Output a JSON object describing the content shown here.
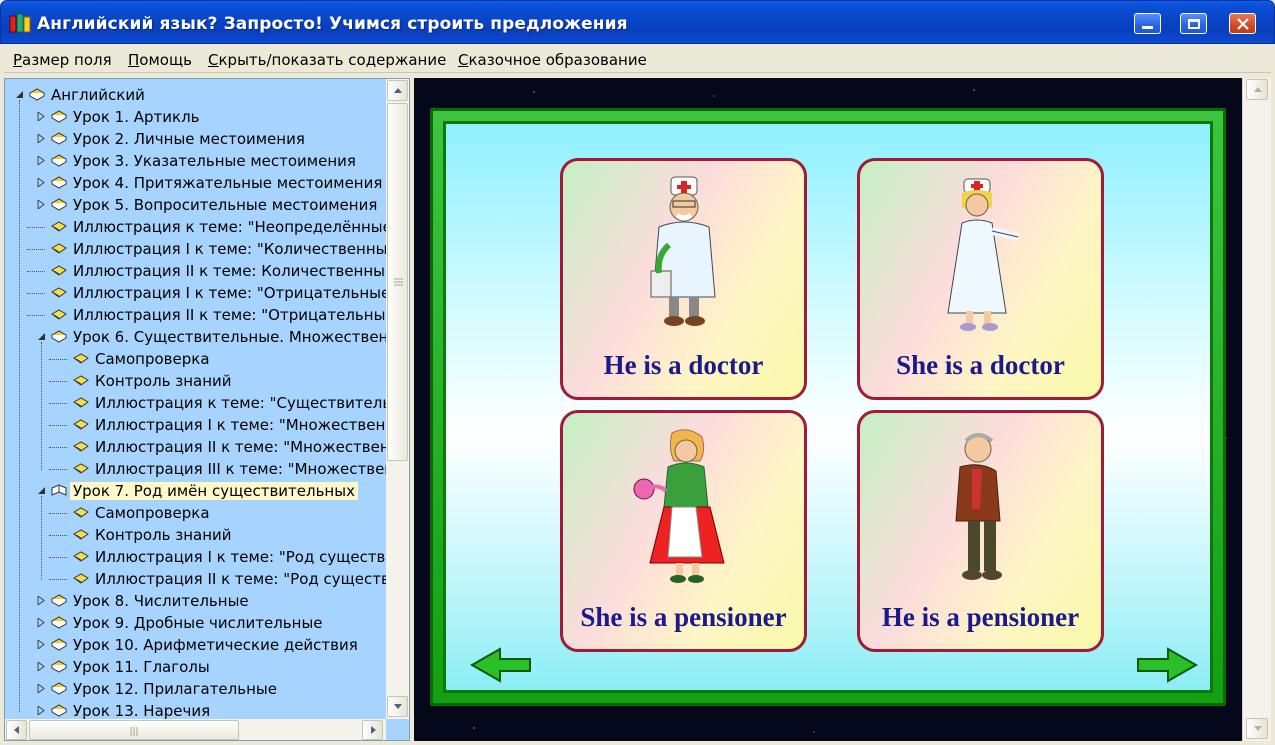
{
  "window": {
    "title": "Английский язык? Запросто! Учимся строить предложения"
  },
  "menu": {
    "items": [
      {
        "label": "Размер поля",
        "underline": "Р",
        "rest": "азмер поля"
      },
      {
        "label": "Помощь",
        "underline": "П",
        "rest": "омощь"
      },
      {
        "label": "Скрыть/показать содержание",
        "underline": "С",
        "rest": "крыть/показать содержание"
      },
      {
        "label": "Сказочное образование",
        "underline": "С",
        "rest": "казочное образование"
      }
    ]
  },
  "tree": {
    "items": [
      {
        "label": "Английский",
        "level": 0,
        "expander": "open",
        "icon": "book-icon"
      },
      {
        "label": "Урок 1. Артикль",
        "level": 1,
        "expander": "closed",
        "icon": "book-icon"
      },
      {
        "label": "Урок 2. Личные местоимения",
        "level": 1,
        "expander": "closed",
        "icon": "book-icon"
      },
      {
        "label": "Урок 3. Указательные местоимения",
        "level": 1,
        "expander": "closed",
        "icon": "book-icon"
      },
      {
        "label": "Урок 4. Притяжательные местоимения",
        "level": 1,
        "expander": "closed",
        "icon": "book-icon"
      },
      {
        "label": "Урок 5. Вопросительные местоимения",
        "level": 1,
        "expander": "closed",
        "icon": "book-icon"
      },
      {
        "label": "Иллюстрация к теме: \"Неопределённые",
        "level": 1,
        "expander": "none",
        "icon": "page-icon"
      },
      {
        "label": "Иллюстрация I к теме: \"Количественные",
        "level": 1,
        "expander": "none",
        "icon": "page-icon"
      },
      {
        "label": "Иллюстрация II к теме: Количественные",
        "level": 1,
        "expander": "none",
        "icon": "page-icon"
      },
      {
        "label": "Иллюстрация I к теме: \"Отрицательные",
        "level": 1,
        "expander": "none",
        "icon": "page-icon"
      },
      {
        "label": "Иллюстрация II к теме: \"Отрицательные",
        "level": 1,
        "expander": "none",
        "icon": "page-icon"
      },
      {
        "label": "Урок 6. Существительные. Множественн",
        "level": 1,
        "expander": "open",
        "icon": "book-icon"
      },
      {
        "label": "Самопроверка",
        "level": 2,
        "expander": "none",
        "icon": "page-icon"
      },
      {
        "label": "Контроль знаний",
        "level": 2,
        "expander": "none",
        "icon": "page-icon"
      },
      {
        "label": "Иллюстрация к теме: \"Существитель",
        "level": 2,
        "expander": "none",
        "icon": "page-icon"
      },
      {
        "label": "Иллюстрация I к теме: \"Множествен",
        "level": 2,
        "expander": "none",
        "icon": "page-icon"
      },
      {
        "label": "Иллюстрация II к теме: \"Множествен",
        "level": 2,
        "expander": "none",
        "icon": "page-icon"
      },
      {
        "label": "Иллюстрация III к теме: \"Множествен",
        "level": 2,
        "expander": "none",
        "icon": "page-icon"
      },
      {
        "label": "Урок 7. Род имён существительных",
        "level": 1,
        "expander": "open",
        "icon": "open-book-icon",
        "selected": true
      },
      {
        "label": "Самопроверка",
        "level": 2,
        "expander": "none",
        "icon": "page-icon"
      },
      {
        "label": "Контроль знаний",
        "level": 2,
        "expander": "none",
        "icon": "page-icon"
      },
      {
        "label": "Иллюстрация I к теме: \"Род существи",
        "level": 2,
        "expander": "none",
        "icon": "page-icon"
      },
      {
        "label": "Иллюстрация II к теме: \"Род существ",
        "level": 2,
        "expander": "none",
        "icon": "page-icon"
      },
      {
        "label": "Урок 8. Числительные",
        "level": 1,
        "expander": "closed",
        "icon": "book-icon"
      },
      {
        "label": "Урок 9. Дробные числительные",
        "level": 1,
        "expander": "closed",
        "icon": "book-icon"
      },
      {
        "label": "Урок 10. Арифметические действия",
        "level": 1,
        "expander": "closed",
        "icon": "book-icon"
      },
      {
        "label": "Урок 11. Глаголы",
        "level": 1,
        "expander": "closed",
        "icon": "book-icon"
      },
      {
        "label": "Урок 12. Прилагательные",
        "level": 1,
        "expander": "closed",
        "icon": "book-icon"
      },
      {
        "label": "Урок 13. Наречия",
        "level": 1,
        "expander": "closed",
        "icon": "book-icon"
      }
    ]
  },
  "cards": [
    {
      "caption": "He is a doctor",
      "figure": "male-doctor"
    },
    {
      "caption": "She is a doctor",
      "figure": "female-doctor"
    },
    {
      "caption": "She is a pensioner",
      "figure": "female-pensioner"
    },
    {
      "caption": "He is a pensioner",
      "figure": "male-pensioner"
    }
  ],
  "colors": {
    "caption": "#1a1a8a",
    "card_border": "#a01a3a",
    "frame": "#12a012",
    "tree_bg": "#a6d4ff",
    "selected_bg": "#fff8c8"
  }
}
